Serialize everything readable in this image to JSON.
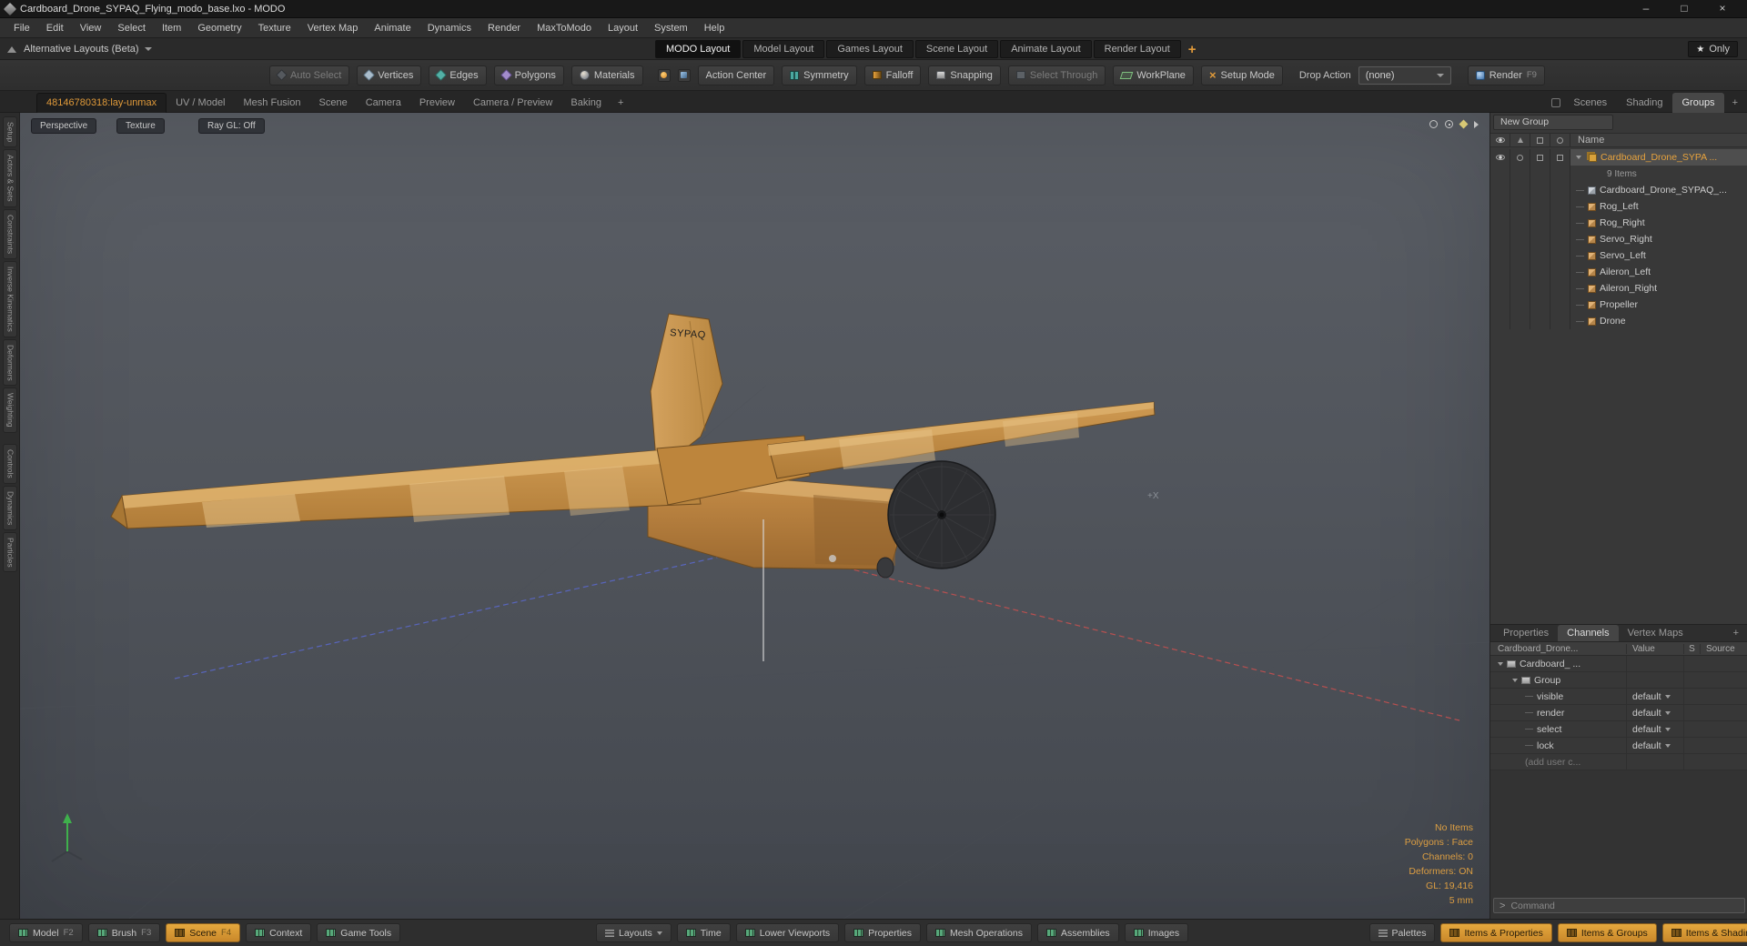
{
  "window": {
    "title": "Cardboard_Drone_SYPAQ_Flying_modo_base.lxo - MODO"
  },
  "menu": {
    "items": [
      "File",
      "Edit",
      "View",
      "Select",
      "Item",
      "Geometry",
      "Texture",
      "Vertex Map",
      "Animate",
      "Dynamics",
      "Render",
      "MaxToModo",
      "Layout",
      "System",
      "Help"
    ]
  },
  "layout_bar": {
    "alt_layouts": "Alternative Layouts (Beta)",
    "tabs": [
      "MODO Layout",
      "Model Layout",
      "Games Layout",
      "Scene Layout",
      "Animate Layout",
      "Render Layout"
    ],
    "add": "+",
    "only": "Only"
  },
  "toolbar": {
    "auto_select": "Auto Select",
    "vertices": "Vertices",
    "edges": "Edges",
    "polygons": "Polygons",
    "materials": "Materials",
    "action_center": "Action Center",
    "symmetry": "Symmetry",
    "falloff": "Falloff",
    "snapping": "Snapping",
    "select_through": "Select Through",
    "workplane": "WorkPlane",
    "setup_mode": "Setup Mode",
    "drop_action": "Drop Action",
    "drop_action_value": "(none)",
    "render": "Render",
    "render_key": "F9"
  },
  "viewport_tabs": {
    "scene_tab": "48146780318:lay-unmax",
    "tabs": [
      "UV / Model",
      "Mesh Fusion",
      "Scene",
      "Camera",
      "Preview",
      "Camera / Preview",
      "Baking"
    ],
    "add": "+",
    "right_tabs": [
      "Scenes",
      "Shading",
      "Groups"
    ],
    "right_add": "+"
  },
  "left_sidebar": {
    "items": [
      "Setup",
      "Actors & Sets",
      "Constraints",
      "Inverse Kinematics",
      "Deformers",
      "Weighting",
      "Controls",
      "Dynamics",
      "Particles"
    ]
  },
  "viewport": {
    "buttons": [
      "Perspective",
      "Texture",
      "Ray GL: Off"
    ],
    "model_label": "SYPAQ",
    "axis_label": "+X",
    "info": [
      "No Items",
      "Polygons : Face",
      "Channels: 0",
      "Deformers: ON",
      "GL: 19,416",
      "5 mm"
    ]
  },
  "groups_panel": {
    "new_group": "New Group",
    "name_header": "Name",
    "root": "Cardboard_Drone_SYPA ...",
    "root_count": "9 Items",
    "items": [
      "Cardboard_Drone_SYPAQ_...",
      "Rog_Left",
      "Rog_Right",
      "Servo_Right",
      "Servo_Left",
      "Aileron_Left",
      "Aileron_Right",
      "Propeller",
      "Drone"
    ]
  },
  "channels_panel": {
    "tabs": [
      "Properties",
      "Channels",
      "Vertex Maps"
    ],
    "add": "+",
    "columns": [
      "Cardboard_Drone...",
      "Value",
      "S",
      "Source"
    ],
    "root_row": "Cardboard_ ...",
    "group_row": "Group",
    "rows": [
      {
        "name": "visible",
        "value": "default"
      },
      {
        "name": "render",
        "value": "default"
      },
      {
        "name": "select",
        "value": "default"
      },
      {
        "name": "lock",
        "value": "default"
      }
    ],
    "add_user": "(add user c...",
    "command_prompt": ">",
    "command_placeholder": "Command"
  },
  "bottom_bar": {
    "left": [
      {
        "label": "Model",
        "key": "F2"
      },
      {
        "label": "Brush",
        "key": "F3"
      },
      {
        "label": "Scene",
        "key": "F4"
      },
      {
        "label": "Context",
        "key": ""
      },
      {
        "label": "Game Tools",
        "key": ""
      }
    ],
    "center": [
      "Layouts",
      "Time",
      "Lower Viewports",
      "Properties",
      "Mesh Operations",
      "Assemblies",
      "Images"
    ],
    "right": [
      "Palettes",
      "Items & Properties",
      "Items & Groups",
      "Items & Shadin"
    ]
  },
  "colors": {
    "accent_orange": "#e09a3a",
    "viewport_top": "#5a5e65",
    "viewport_bottom": "#43474e",
    "cardboard": "#c9924d",
    "propeller": "#2d2e31",
    "axis_red": "#c45050",
    "axis_blue": "#5a68c8",
    "axis_green": "#3fb04c"
  }
}
